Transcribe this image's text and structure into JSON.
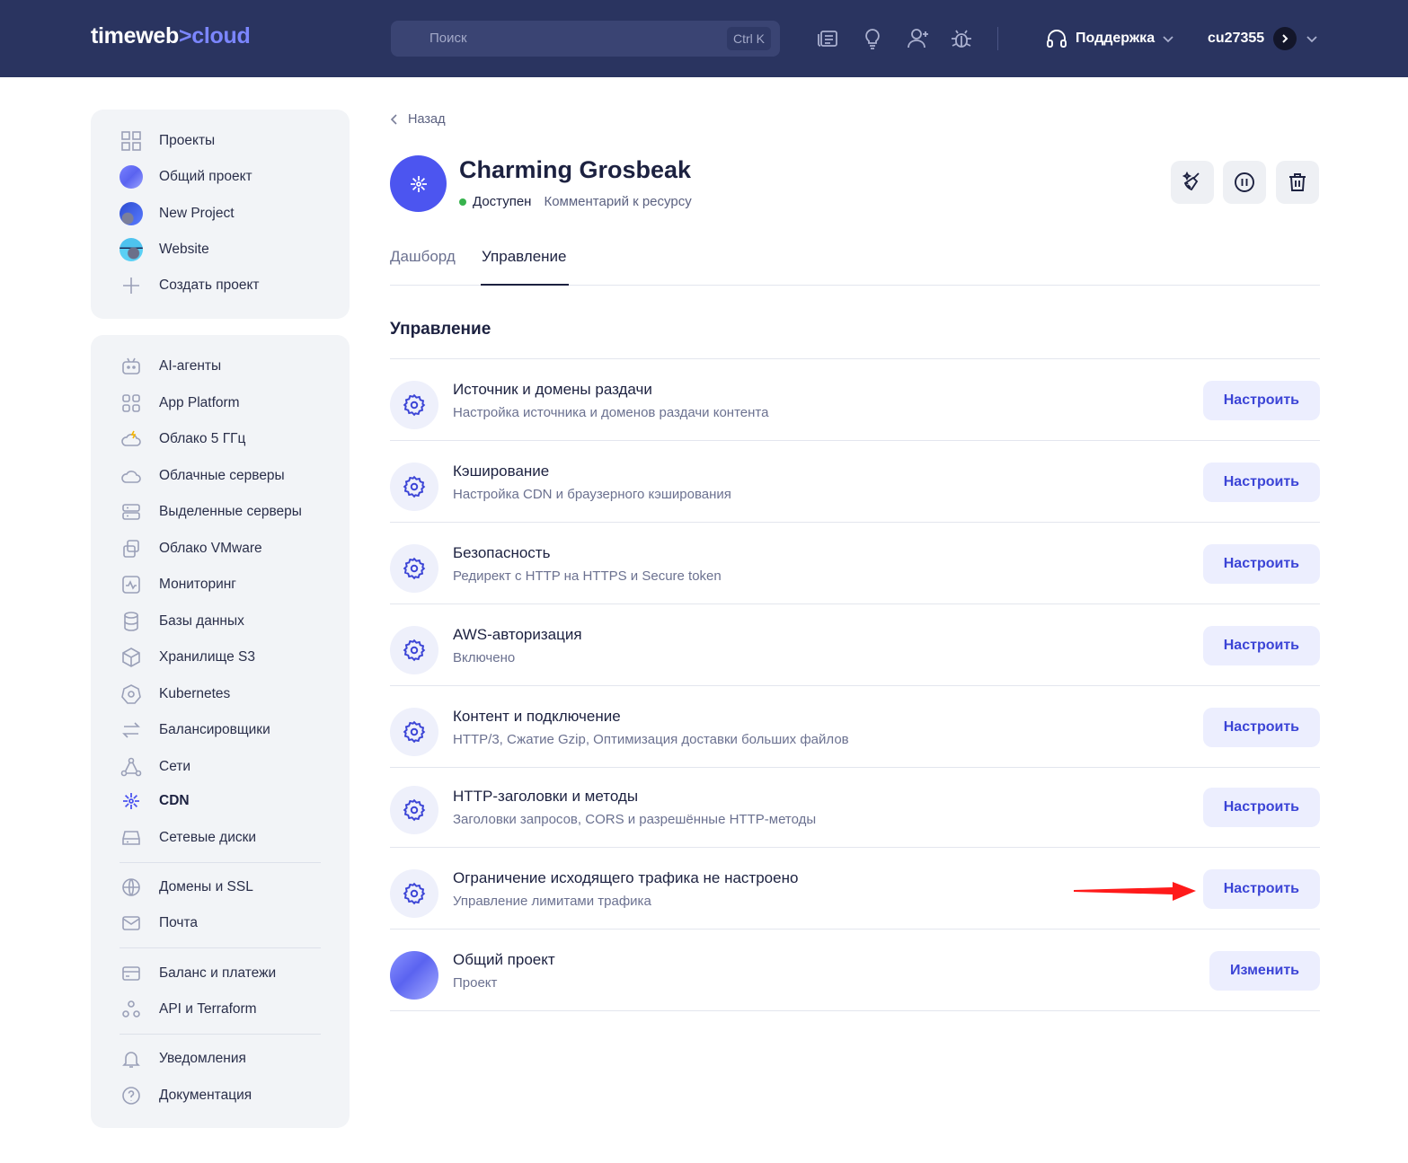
{
  "header": {
    "logo_main": "timeweb",
    "logo_arrow": ">",
    "logo_accent": "cloud",
    "search_placeholder": "Поиск",
    "search_shortcut": "Ctrl K",
    "support_label": "Поддержка",
    "username": "cu27355"
  },
  "projects": [
    {
      "label": "Проекты",
      "icon": "grid-icon"
    },
    {
      "label": "Общий проект",
      "icon": "project-avatar"
    },
    {
      "label": "New Project",
      "icon": "project-avatar"
    },
    {
      "label": "Website",
      "icon": "project-avatar"
    },
    {
      "label": "Создать проект",
      "icon": "plus-icon"
    }
  ],
  "services": [
    {
      "label": "AI-агенты",
      "icon": "robot-icon"
    },
    {
      "label": "App Platform",
      "icon": "apps-icon"
    },
    {
      "label": "Облако 5 ГГц",
      "icon": "cloud-bolt-icon"
    },
    {
      "label": "Облачные серверы",
      "icon": "cloud-icon"
    },
    {
      "label": "Выделенные серверы",
      "icon": "server-icon"
    },
    {
      "label": "Облако VMware",
      "icon": "vmware-icon"
    },
    {
      "label": "Мониторинг",
      "icon": "monitoring-icon"
    },
    {
      "label": "Базы данных",
      "icon": "database-icon"
    },
    {
      "label": "Хранилище S3",
      "icon": "cube-icon"
    },
    {
      "label": "Kubernetes",
      "icon": "kubernetes-icon"
    },
    {
      "label": "Балансировщики",
      "icon": "arrows-icon"
    },
    {
      "label": "Сети",
      "icon": "network-icon"
    },
    {
      "label": "CDN",
      "icon": "cdn-icon"
    },
    {
      "label": "Сетевые диски",
      "icon": "disk-icon"
    },
    {
      "label": "Домены и SSL",
      "icon": "globe-icon"
    },
    {
      "label": "Почта",
      "icon": "mail-icon"
    },
    {
      "label": "Баланс и платежи",
      "icon": "card-icon"
    },
    {
      "label": "API и Terraform",
      "icon": "api-icon"
    },
    {
      "label": "Уведомления",
      "icon": "bell-icon"
    },
    {
      "label": "Документация",
      "icon": "help-icon"
    }
  ],
  "page": {
    "back_label": "Назад",
    "resource_name": "Charming Grosbeak",
    "status": "Доступен",
    "comment_link": "Комментарий к ресурсу",
    "tabs": [
      "Дашборд",
      "Управление"
    ],
    "section_title": "Управление"
  },
  "settings": [
    {
      "title": "Источник и домены раздачи",
      "subtitle": "Настройка источника и доменов раздачи контента",
      "button": "Настроить"
    },
    {
      "title": "Кэширование",
      "subtitle": "Настройка CDN и браузерного кэширования",
      "button": "Настроить"
    },
    {
      "title": "Безопасность",
      "subtitle": "Редирект с HTTP на HTTPS и Secure token",
      "button": "Настроить"
    },
    {
      "title": "AWS-авторизация",
      "subtitle": "Включено",
      "button": "Настроить"
    },
    {
      "title": "Контент и подключение",
      "subtitle": "HTTP/3, Сжатие Gzip, Оптимизация доставки больших файлов",
      "button": "Настроить"
    },
    {
      "title": "HTTP-заголовки и методы",
      "subtitle": "Заголовки запросов, CORS и разрешённые HTTP-методы",
      "button": "Настроить"
    },
    {
      "title": "Ограничение исходящего трафика не настроено",
      "subtitle": "Управление лимитами трафика",
      "button": "Настроить"
    },
    {
      "title": "Общий проект",
      "subtitle": "Проект",
      "button": "Изменить"
    }
  ],
  "colors": {
    "accent": "#4c55f0",
    "topbar": "#2a3460",
    "status_ok": "#37b24d",
    "annotation_arrow": "#ff1a1a"
  }
}
